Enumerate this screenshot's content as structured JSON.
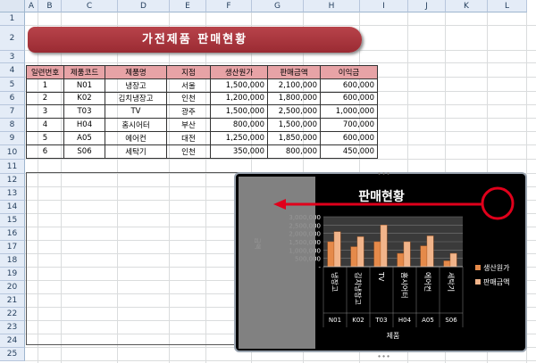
{
  "columns": [
    "A",
    "B",
    "C",
    "D",
    "E",
    "F",
    "G",
    "H",
    "I",
    "J",
    "K",
    "L"
  ],
  "rows": [
    "1",
    "2",
    "3",
    "4",
    "5",
    "6",
    "7",
    "8",
    "9",
    "10",
    "11",
    "12",
    "13",
    "14",
    "15",
    "16",
    "17",
    "18",
    "19",
    "20",
    "21",
    "22",
    "23",
    "24",
    "25"
  ],
  "banner_title": "가전제품 판매현황",
  "table": {
    "headers": [
      "일련번호",
      "제품코드",
      "제품명",
      "지점",
      "생산원가",
      "판매금액",
      "이익금"
    ],
    "rows": [
      [
        "1",
        "N01",
        "냉장고",
        "서울",
        "1,500,000",
        "2,100,000",
        "600,000"
      ],
      [
        "2",
        "K02",
        "김치냉장고",
        "인천",
        "1,200,000",
        "1,800,000",
        "600,000"
      ],
      [
        "3",
        "T03",
        "TV",
        "광주",
        "1,500,000",
        "2,500,000",
        "1,000,000"
      ],
      [
        "4",
        "H04",
        "홈시어터",
        "부산",
        "800,000",
        "1,500,000",
        "700,000"
      ],
      [
        "5",
        "A05",
        "에어컨",
        "대전",
        "1,250,000",
        "1,850,000",
        "600,000"
      ],
      [
        "6",
        "S06",
        "세탁기",
        "인천",
        "350,000",
        "800,000",
        "450,000"
      ]
    ]
  },
  "colors": {
    "header_fill": "#e7a3a6",
    "banner": "#a8343c",
    "series1": "#e58a4a",
    "series2": "#f1b48a",
    "arrow": "#e0001b"
  },
  "chart_data": {
    "type": "bar",
    "title": "판매현황",
    "xlabel": "제품",
    "ylabel": "금액",
    "categories": [
      "냉장고",
      "김치냉장고",
      "TV",
      "홈시어터",
      "에어컨",
      "세탁기"
    ],
    "codes": [
      "N01",
      "K02",
      "T03",
      "H04",
      "A05",
      "S06"
    ],
    "series": [
      {
        "name": "생산원가",
        "values": [
          1500000,
          1200000,
          1500000,
          800000,
          1250000,
          350000
        ]
      },
      {
        "name": "판매금액",
        "values": [
          2100000,
          1800000,
          2500000,
          1500000,
          1850000,
          800000
        ]
      }
    ],
    "ylim": [
      0,
      3000000
    ],
    "yticks": [
      "3,000,000",
      "2,500,000",
      "2,000,000",
      "1,500,000",
      "1,000,000",
      "500,000",
      "-"
    ],
    "legend": "right",
    "grid": true
  }
}
